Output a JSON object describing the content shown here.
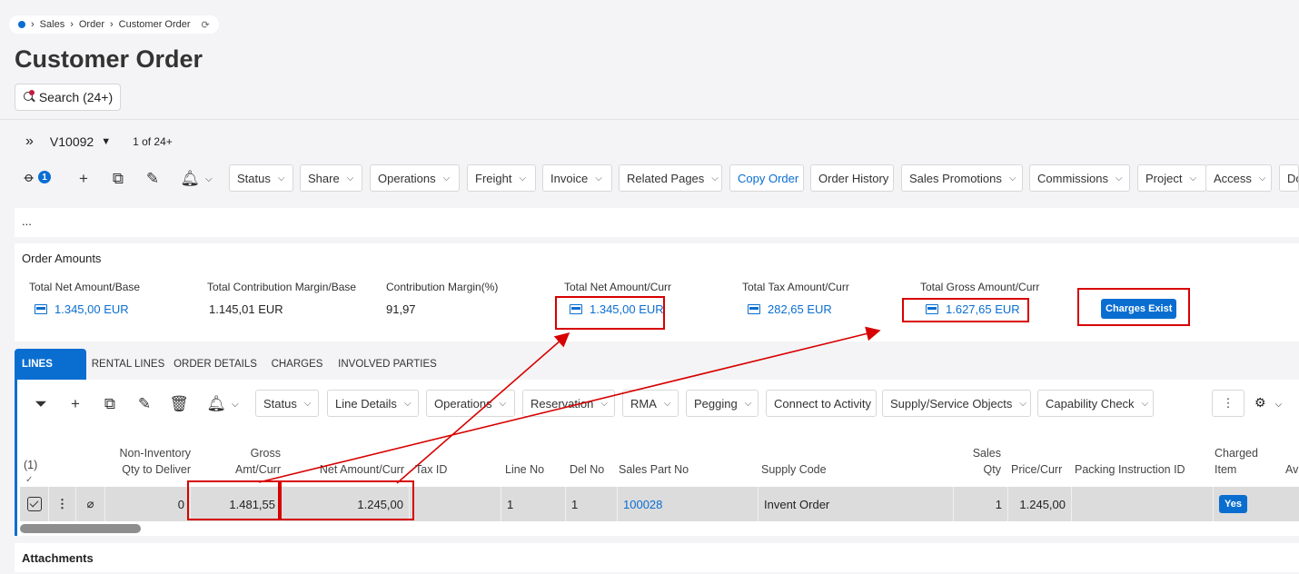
{
  "breadcrumb": {
    "items": [
      "Sales",
      "Order",
      "Customer Order"
    ]
  },
  "page_title": "Customer Order",
  "search_label": "Search (24+)",
  "record": {
    "id": "V10092",
    "count": "1 of 24+"
  },
  "attachment_count": "1",
  "toolbar": {
    "buttons": [
      "Status",
      "Share",
      "Operations",
      "Freight",
      "Invoice",
      "Related Pages",
      "Copy Order",
      "Order History",
      "Sales Promotions",
      "Commissions",
      "Project",
      "Access",
      "Do"
    ]
  },
  "ellipsis": "...",
  "order_amounts": {
    "title": "Order Amounts",
    "labels": [
      "Total Net Amount/Base",
      "Total Contribution Margin/Base",
      "Contribution Margin(%)",
      "Total Net Amount/Curr",
      "Total Tax Amount/Curr",
      "Total Gross Amount/Curr"
    ],
    "values": [
      "1.345,00 EUR",
      "1.145,01 EUR",
      "91,97",
      "1.345,00 EUR",
      "282,65 EUR",
      "1.627,65 EUR"
    ],
    "charges_badge": "Charges Exist"
  },
  "tabs": [
    "LINES",
    "RENTAL LINES",
    "ORDER DETAILS",
    "CHARGES",
    "INVOLVED PARTIES"
  ],
  "lines_toolbar": {
    "buttons": [
      "Status",
      "Line Details",
      "Operations",
      "Reservation",
      "RMA",
      "Pegging",
      "Connect to Activity",
      "Supply/Service Objects",
      "Capability Check"
    ]
  },
  "table": {
    "selection_count": "(1)",
    "headers": {
      "non_inventory_1": "Non-Inventory",
      "non_inventory_2": "Qty to Deliver",
      "gross_1": "Gross",
      "gross_2": "Amt/Curr",
      "net_amount": "Net Amount/Curr",
      "tax_id": "Tax ID",
      "line_no": "Line No",
      "del_no": "Del No",
      "sales_part_no": "Sales Part No",
      "supply_code": "Supply Code",
      "sales_qty_1": "Sales",
      "sales_qty_2": "Qty",
      "price_curr": "Price/Curr",
      "packing": "Packing Instruction ID",
      "charged_1": "Charged",
      "charged_2": "Item",
      "av": "Av"
    },
    "row": {
      "qty_to_deliver": "0",
      "gross_amt": "1.481,55",
      "net_amount": "1.245,00",
      "line_no": "1",
      "del_no": "1",
      "sales_part_no": "100028",
      "supply_code": "Invent Order",
      "sales_qty": "1",
      "price_curr": "1.245,00",
      "charged_item": "Yes"
    }
  },
  "attachments_title": "Attachments",
  "colors": {
    "accent": "#0a6ed1",
    "highlight": "#d70000",
    "row_bg": "#dcdcdc"
  }
}
